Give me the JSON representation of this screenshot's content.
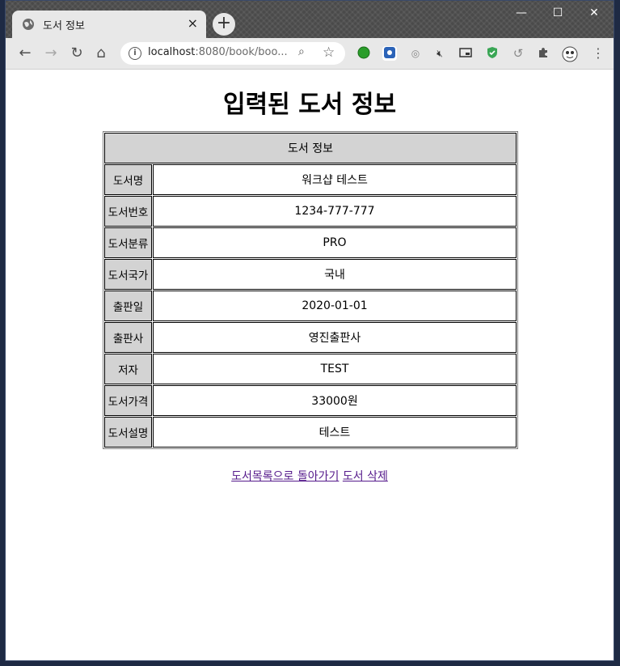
{
  "browser": {
    "tab_title": "도서 정보",
    "tab_close": "×",
    "new_tab": "+",
    "url_host": "localhost",
    "url_rest": ":8080/book/boo...",
    "win_min": "—",
    "win_max": "☐",
    "win_close": "✕"
  },
  "page": {
    "heading": "입력된 도서 정보",
    "table_header": "도서 정보",
    "rows": [
      {
        "label": "도서명",
        "value": "워크샵 테스트"
      },
      {
        "label": "도서번호",
        "value": "1234-777-777"
      },
      {
        "label": "도서분류",
        "value": "PRO"
      },
      {
        "label": "도서국가",
        "value": "국내"
      },
      {
        "label": "출판일",
        "value": "2020-01-01"
      },
      {
        "label": "출판사",
        "value": "영진출판사"
      },
      {
        "label": "저자",
        "value": "TEST"
      },
      {
        "label": "도서가격",
        "value": "33000원"
      },
      {
        "label": "도서설명",
        "value": "테스트"
      }
    ],
    "link_back": "도서목록으로 돌아가기",
    "link_delete": "도서 삭제"
  },
  "colors": {
    "header_bg": "#d3d3d3",
    "link": "#551a8b"
  }
}
